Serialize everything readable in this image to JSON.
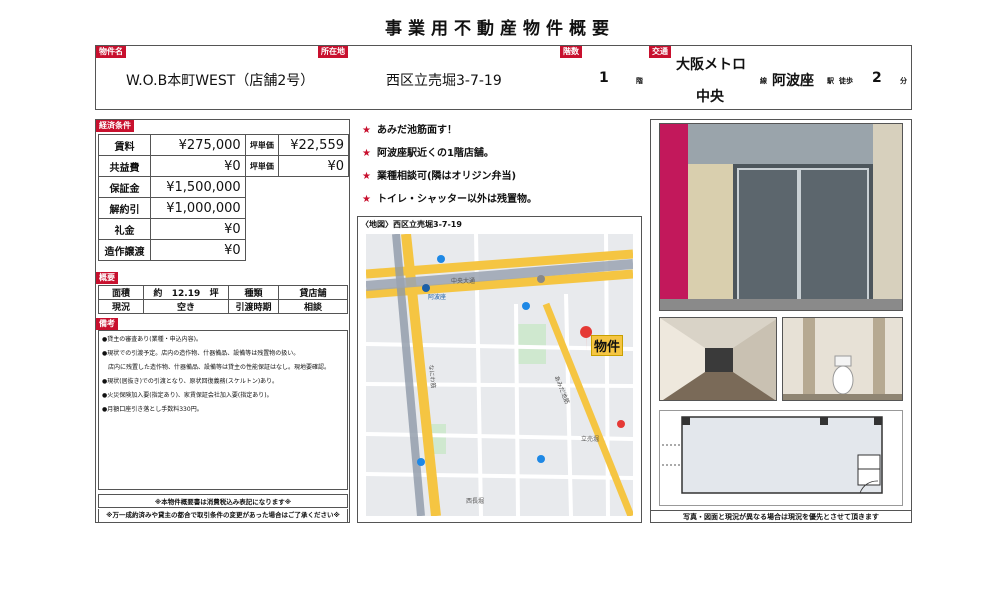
{
  "title": "事業用不動産物件概要",
  "header": {
    "property_name_label": "物件名",
    "property_name": "W.O.B本町WEST（店舗2号）",
    "location_label": "所在地",
    "location": "西区立売堀3-7-19",
    "floor_label": "階数",
    "floor": "1",
    "floor_unit": "階",
    "transport_label": "交通",
    "line_1": "大阪メトロ",
    "line_2": "中央",
    "line_unit": "線",
    "station": "阿波座",
    "station_unit": "駅",
    "walk_label": "徒歩",
    "walk_minutes": "2",
    "walk_unit": "分"
  },
  "conditions": {
    "label": "経済条件",
    "rent_label": "賃料",
    "rent": "¥275,000",
    "tsubo_label_1": "坪単価",
    "tsubo_1": "¥22,559",
    "common_label": "共益費",
    "common": "¥0",
    "tsubo_label_2": "坪単価",
    "tsubo_2": "¥0",
    "deposit_label": "保証金",
    "deposit": "¥1,500,000",
    "amortization_label": "解約引",
    "amortization": "¥1,000,000",
    "key_money_label": "礼金",
    "key_money": "¥0",
    "transfer_label": "造作譲渡",
    "transfer": "¥0"
  },
  "overview": {
    "label": "概要",
    "area_label": "面積",
    "area_approx": "約",
    "area_value": "12.19",
    "area_unit": "坪",
    "type_label": "種類",
    "type_value": "貸店舗",
    "status_label": "現況",
    "status_value": "空き",
    "handover_label": "引渡時期",
    "handover_value": "相談"
  },
  "remarks": {
    "label": "備考",
    "lines": [
      "●貸主の審査あり(業種・申込内容)。",
      "●現状での引渡予定。店内の造作物、什器備品、設備等は残置物の扱い。",
      "　店内に残置した造作物、什器備品、設備等は貸主の性能保証はなし。現地要確認。",
      "●現状(居抜き)での引渡となり、原状回復義務(スケルトン)あり。",
      "●火災保険加入要(指定あり)、家賃保証会社加入要(指定あり)。",
      "●月額口座引き落とし手数料330円。"
    ],
    "tax_note": "※本物件概要書は消費税込み表記になります※",
    "disclaimer": "※万一成約済みや貸主の都合で取引条件の変更があった場合はご了承ください※"
  },
  "features": [
    "あみだ池筋面す！",
    "阿波座駅近くの1階店舗。",
    "業種相談可(隣はオリジン弁当)",
    "トイレ・シャッター以外は残置物。"
  ],
  "map": {
    "caption": "〈地図〉西区立売堀3-7-19",
    "marker_label": "物件",
    "labels": {
      "chuo_odori": "中央大通",
      "itachibori": "立売堀",
      "amidaike": "あみだ池筋",
      "nishinagahori": "西長堀",
      "awaza": "阿波座",
      "naniwasuji": "なにわ筋"
    }
  },
  "photos_footer": "写真・図面と現況が異なる場合は現況を優先とさせて頂きます",
  "colors": {
    "accent": "#c8102e",
    "border": "#555555",
    "map_yellow": "#f5c542"
  }
}
